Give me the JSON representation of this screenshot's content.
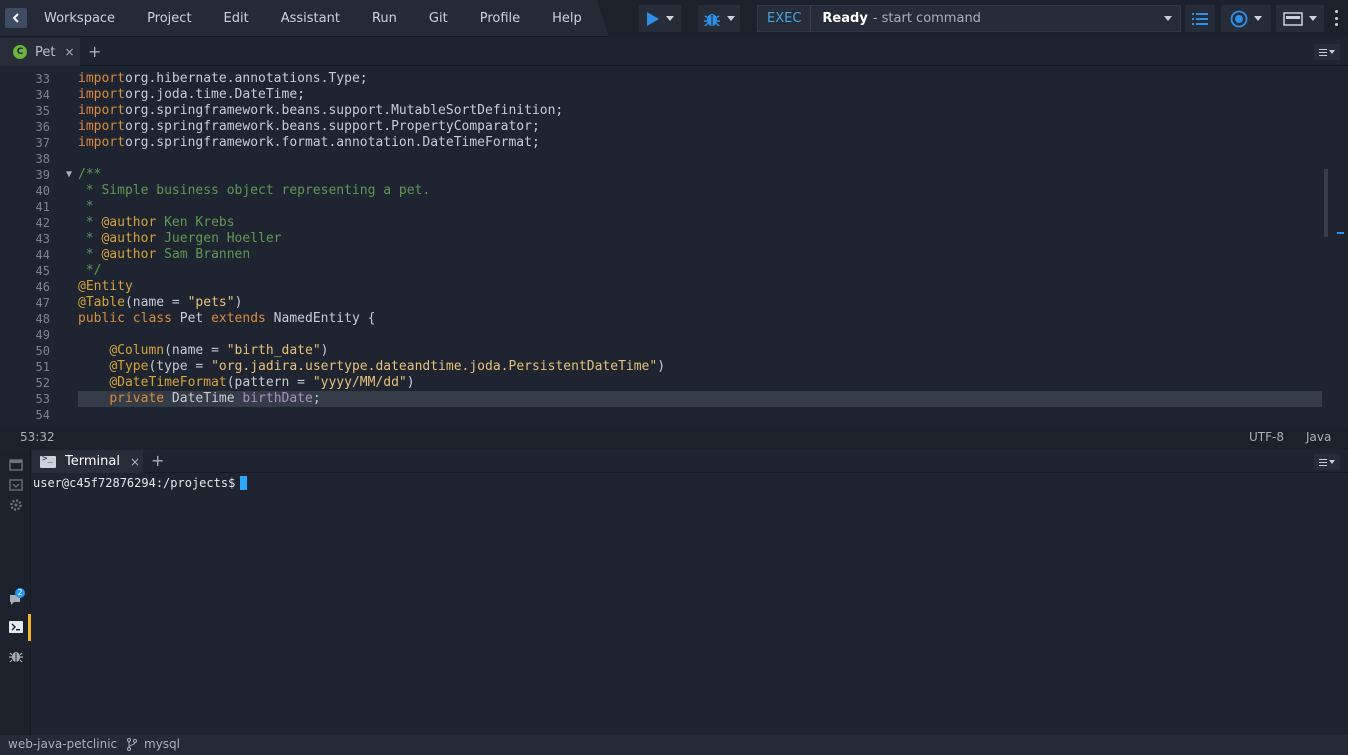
{
  "menubar": {
    "items": [
      "Workspace",
      "Project",
      "Edit",
      "Assistant",
      "Run",
      "Git",
      "Profile",
      "Help"
    ],
    "exec_label": "EXEC",
    "command_status": "Ready",
    "command_hint": "- start command"
  },
  "editor_tabs": [
    {
      "label": "Pet",
      "icon_letter": "C",
      "close": "×"
    }
  ],
  "add_tab_symbol": "+",
  "code_lines": [
    {
      "num": "33",
      "tokens": [
        [
          "kw",
          "import"
        ],
        [
          "",
          "org.hibernate.annotations.Type;"
        ]
      ]
    },
    {
      "num": "34",
      "tokens": [
        [
          "kw",
          "import"
        ],
        [
          "",
          "org.joda.time.DateTime;"
        ]
      ]
    },
    {
      "num": "35",
      "tokens": [
        [
          "kw",
          "import"
        ],
        [
          "",
          "org.springframework.beans.support.MutableSortDefinition;"
        ]
      ]
    },
    {
      "num": "36",
      "tokens": [
        [
          "kw",
          "import"
        ],
        [
          "",
          "org.springframework.beans.support.PropertyComparator;"
        ]
      ]
    },
    {
      "num": "37",
      "tokens": [
        [
          "kw",
          "import"
        ],
        [
          "",
          "org.springframework.format.annotation.DateTimeFormat;"
        ]
      ]
    },
    {
      "num": "38",
      "tokens": []
    },
    {
      "num": "39",
      "fold": "▼",
      "tokens": [
        [
          "cm",
          "/**"
        ]
      ]
    },
    {
      "num": "40",
      "tokens": [
        [
          "cm",
          " * Simple business object representing a pet."
        ]
      ]
    },
    {
      "num": "41",
      "tokens": [
        [
          "cm",
          " *"
        ]
      ]
    },
    {
      "num": "42",
      "tokens": [
        [
          "cm",
          " * "
        ],
        [
          "ann",
          "@author"
        ],
        [
          "cm",
          " Ken Krebs"
        ]
      ]
    },
    {
      "num": "43",
      "tokens": [
        [
          "cm",
          " * "
        ],
        [
          "ann",
          "@author"
        ],
        [
          "cm",
          " Juergen Hoeller"
        ]
      ]
    },
    {
      "num": "44",
      "tokens": [
        [
          "cm",
          " * "
        ],
        [
          "ann",
          "@author"
        ],
        [
          "cm",
          " Sam Brannen"
        ]
      ]
    },
    {
      "num": "45",
      "tokens": [
        [
          "cm",
          " */"
        ]
      ]
    },
    {
      "num": "46",
      "tokens": [
        [
          "ann",
          "@Entity"
        ]
      ]
    },
    {
      "num": "47",
      "tokens": [
        [
          "ann",
          "@Table"
        ],
        [
          "",
          "(name = "
        ],
        [
          "str",
          "\"pets\""
        ],
        [
          "",
          ")"
        ]
      ]
    },
    {
      "num": "48",
      "tokens": [
        [
          "kw",
          "public class"
        ],
        [
          "",
          " Pet "
        ],
        [
          "kw",
          "extends"
        ],
        [
          "",
          " NamedEntity {"
        ]
      ]
    },
    {
      "num": "49",
      "tokens": []
    },
    {
      "num": "50",
      "tokens": [
        [
          "",
          "    "
        ],
        [
          "ann",
          "@Column"
        ],
        [
          "",
          "(name = "
        ],
        [
          "str",
          "\"birth_date\""
        ],
        [
          "",
          ")"
        ]
      ]
    },
    {
      "num": "51",
      "tokens": [
        [
          "",
          "    "
        ],
        [
          "ann",
          "@Type"
        ],
        [
          "",
          "(type = "
        ],
        [
          "str",
          "\"org.jadira.usertype.dateandtime.joda.PersistentDateTime\""
        ],
        [
          "",
          ")"
        ]
      ]
    },
    {
      "num": "52",
      "tokens": [
        [
          "",
          "    "
        ],
        [
          "ann",
          "@DateTimeFormat"
        ],
        [
          "",
          "(pattern = "
        ],
        [
          "str",
          "\"yyyy/MM/dd\""
        ],
        [
          "",
          ")"
        ]
      ]
    },
    {
      "num": "53",
      "current": true,
      "tokens": [
        [
          "",
          "    "
        ],
        [
          "kw",
          "private"
        ],
        [
          "",
          " DateTime "
        ],
        [
          "fld",
          "birthDate"
        ],
        [
          "",
          ";"
        ]
      ]
    },
    {
      "num": "54",
      "tokens": []
    }
  ],
  "status": {
    "cursor_position": "53:32",
    "encoding": "UTF-8",
    "language": "Java"
  },
  "terminal": {
    "tab_label": "Terminal",
    "close": "×",
    "prompt": "user@c45f72876294:/projects$"
  },
  "sidebar": {
    "notification_count": "2"
  },
  "bottombar": {
    "project": "web-java-petclinic",
    "branch": "mysql"
  },
  "colors": {
    "accent": "#2196f3",
    "keyword": "#d98b3e",
    "comment": "#629755",
    "annotation": "#d4a33a",
    "string": "#e8c07a"
  }
}
